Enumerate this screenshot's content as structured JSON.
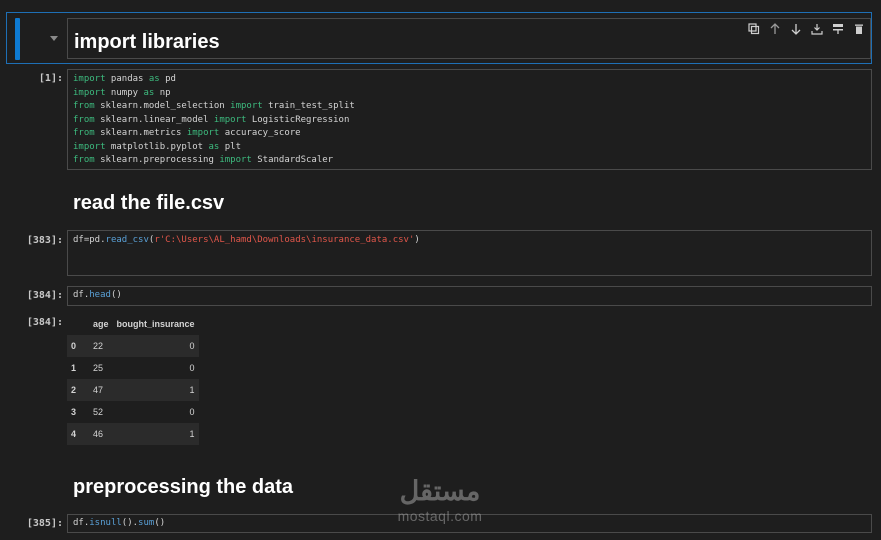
{
  "cells": {
    "md1": {
      "heading": "import libraries"
    },
    "code1": {
      "prompt": "[1]:",
      "lines": [
        [
          {
            "t": "import",
            "c": "kw"
          },
          {
            "t": " pandas ",
            "c": ""
          },
          {
            "t": "as",
            "c": "kw"
          },
          {
            "t": " pd",
            "c": ""
          }
        ],
        [
          {
            "t": "import",
            "c": "kw"
          },
          {
            "t": " numpy ",
            "c": ""
          },
          {
            "t": "as",
            "c": "kw"
          },
          {
            "t": " np",
            "c": ""
          }
        ],
        [
          {
            "t": "from",
            "c": "kw"
          },
          {
            "t": " sklearn.model_selection ",
            "c": ""
          },
          {
            "t": "import",
            "c": "kw"
          },
          {
            "t": " train_test_split",
            "c": ""
          }
        ],
        [
          {
            "t": "from",
            "c": "kw"
          },
          {
            "t": " sklearn.linear_model ",
            "c": ""
          },
          {
            "t": "import",
            "c": "kw"
          },
          {
            "t": " LogisticRegression",
            "c": ""
          }
        ],
        [
          {
            "t": "from",
            "c": "kw"
          },
          {
            "t": " sklearn.metrics ",
            "c": ""
          },
          {
            "t": "import",
            "c": "kw"
          },
          {
            "t": " accuracy_score",
            "c": ""
          }
        ],
        [
          {
            "t": "import",
            "c": "kw"
          },
          {
            "t": " matplotlib.pyplot ",
            "c": ""
          },
          {
            "t": "as",
            "c": "kw"
          },
          {
            "t": " plt",
            "c": ""
          }
        ],
        [
          {
            "t": "from",
            "c": "kw"
          },
          {
            "t": " sklearn.preprocessing ",
            "c": ""
          },
          {
            "t": "import",
            "c": "kw"
          },
          {
            "t": " StandardScaler",
            "c": ""
          }
        ]
      ]
    },
    "md2": {
      "heading": "read the file.csv"
    },
    "code2": {
      "prompt": "[383]:",
      "lines": [
        [
          {
            "t": "df",
            "c": ""
          },
          {
            "t": "=",
            "c": ""
          },
          {
            "t": "pd",
            "c": ""
          },
          {
            "t": ".",
            "c": ""
          },
          {
            "t": "read_csv",
            "c": "fn"
          },
          {
            "t": "(",
            "c": ""
          },
          {
            "t": "r'C:\\Users\\AL_hamd\\Downloads\\insurance_data.csv'",
            "c": "str"
          },
          {
            "t": ")",
            "c": ""
          }
        ]
      ]
    },
    "code3": {
      "prompt": "[384]:",
      "lines": [
        [
          {
            "t": "df",
            "c": ""
          },
          {
            "t": ".",
            "c": ""
          },
          {
            "t": "head",
            "c": "fn"
          },
          {
            "t": "()",
            "c": ""
          }
        ]
      ]
    },
    "out3": {
      "prompt": "[384]:",
      "columns": [
        "age",
        "bought_insurance"
      ],
      "rows": [
        {
          "index": "0",
          "age": "22",
          "bought_insurance": "0"
        },
        {
          "index": "1",
          "age": "25",
          "bought_insurance": "0"
        },
        {
          "index": "2",
          "age": "47",
          "bought_insurance": "1"
        },
        {
          "index": "3",
          "age": "52",
          "bought_insurance": "0"
        },
        {
          "index": "4",
          "age": "46",
          "bought_insurance": "1"
        }
      ]
    },
    "md3": {
      "heading": "preprocessing the data"
    },
    "code4": {
      "prompt": "[385]:",
      "lines": [
        [
          {
            "t": "df",
            "c": ""
          },
          {
            "t": ".",
            "c": ""
          },
          {
            "t": "isnull",
            "c": "fn"
          },
          {
            "t": "().",
            "c": ""
          },
          {
            "t": "sum",
            "c": "fn"
          },
          {
            "t": "()",
            "c": ""
          }
        ]
      ]
    }
  },
  "toolbar": {
    "icons": [
      "duplicate-icon",
      "move-up-icon",
      "move-down-icon",
      "insert-below-icon",
      "merge-icon",
      "delete-icon"
    ]
  },
  "watermark": {
    "arabic": "مستقل",
    "latin": "mostaql.com"
  },
  "colors": {
    "background": "#1e1e1e",
    "selection": "#0e7ad1",
    "keyword": "#3dba7e",
    "function": "#5aa0d6",
    "string": "#e0564a"
  }
}
